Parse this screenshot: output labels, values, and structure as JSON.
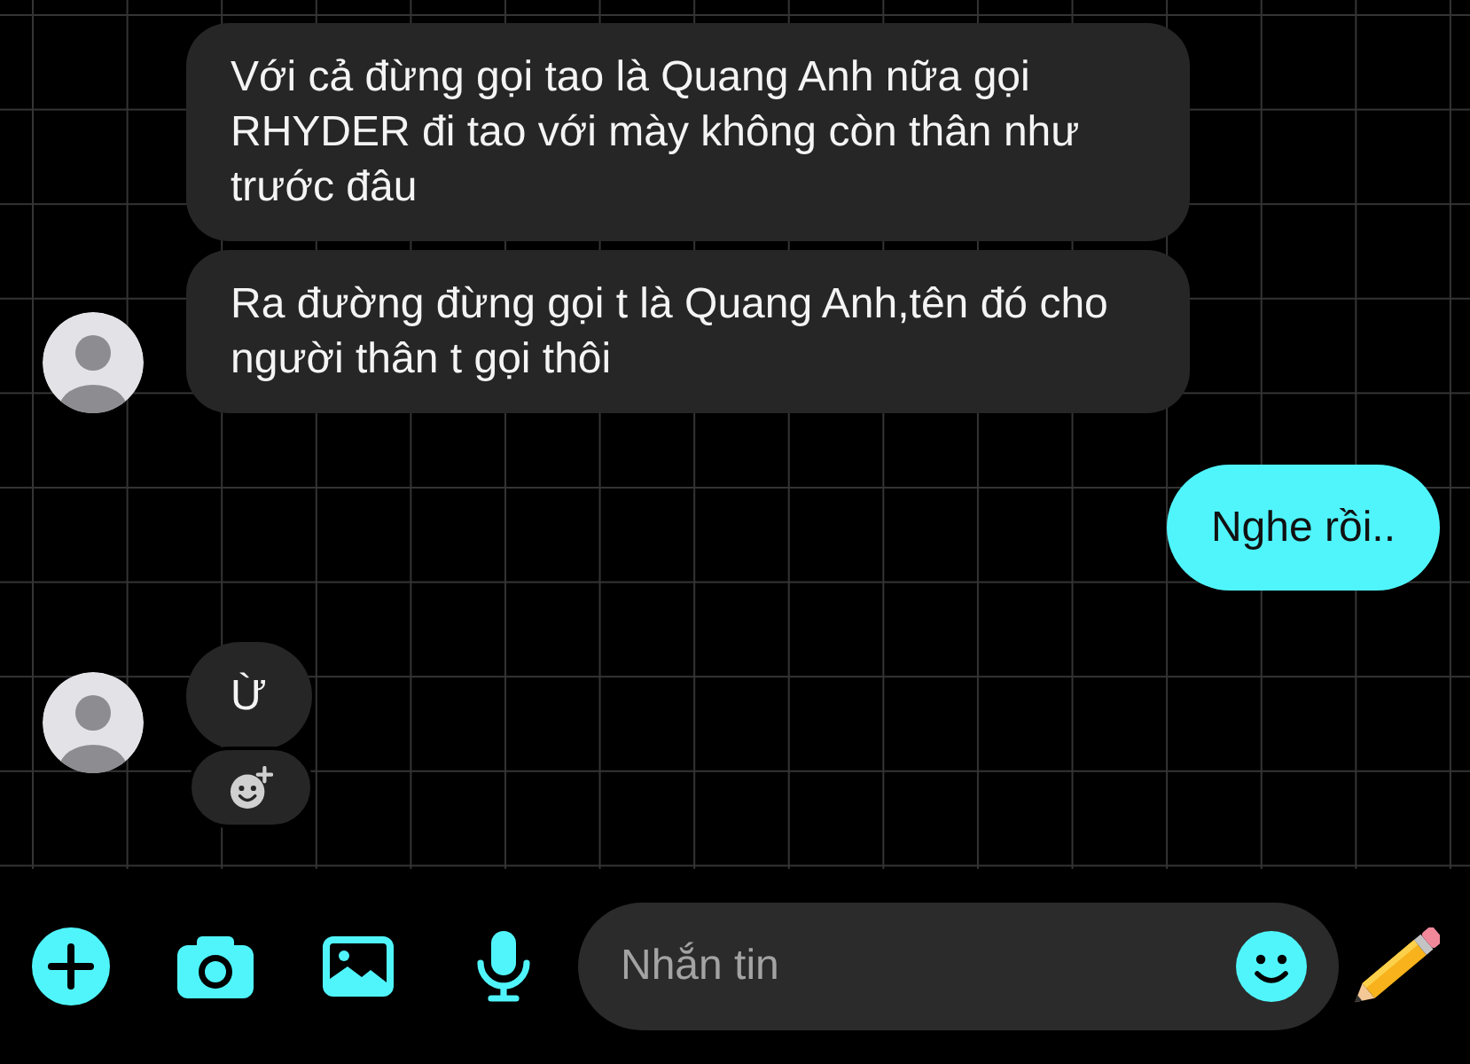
{
  "messages": [
    {
      "kind": "incoming",
      "text": "Với cả đừng gọi tao là Quang Anh nữa gọi RHYDER đi tao với mày không còn thân như trước đâu",
      "avatar": false,
      "reaction_button": false
    },
    {
      "kind": "incoming",
      "text": "Ra đường đừng gọi t là Quang Anh,tên đó cho người thân t gọi thôi",
      "avatar": true,
      "reaction_button": false
    },
    {
      "kind": "outgoing",
      "text": "Nghe rồi.."
    },
    {
      "kind": "incoming",
      "text": "Ừ",
      "avatar": true,
      "reaction_button": true
    }
  ],
  "composer": {
    "placeholder": "Nhắn tin"
  }
}
